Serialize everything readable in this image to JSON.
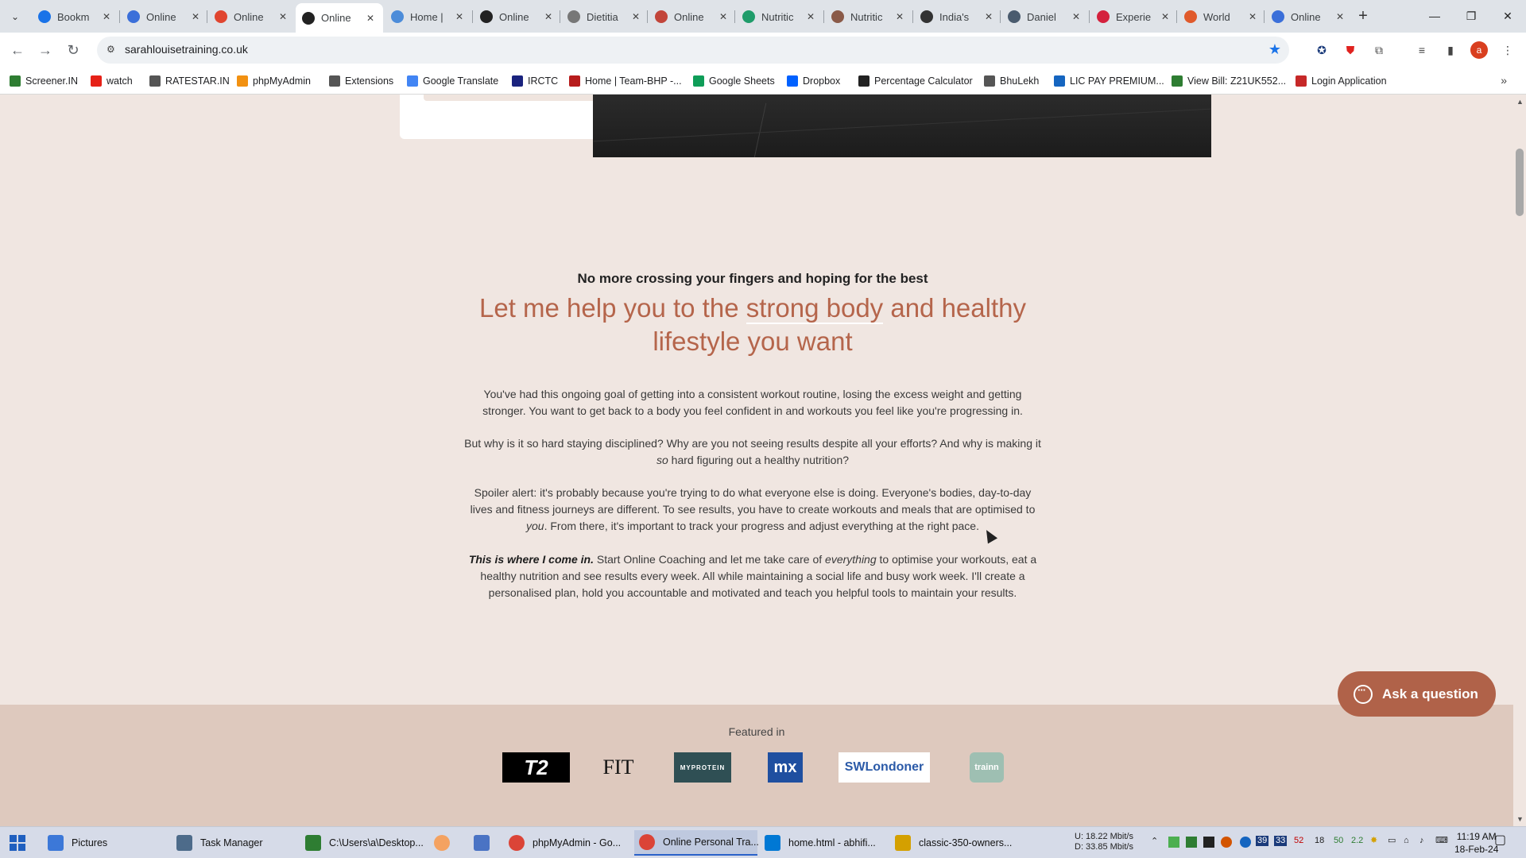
{
  "browser": {
    "tabs": [
      {
        "title": "Bookm",
        "icon_color": "#1a73e8"
      },
      {
        "title": "Online",
        "icon_color": "#3b6fd9"
      },
      {
        "title": "Online",
        "icon_color": "#e0452f"
      },
      {
        "title": "Online",
        "icon_color": "#222222",
        "active": true
      },
      {
        "title": "Home |",
        "icon_color": "#4c8cd9"
      },
      {
        "title": "Online",
        "icon_color": "#222222"
      },
      {
        "title": "Dietitia",
        "icon_color": "#777777"
      },
      {
        "title": "Online",
        "icon_color": "#c2453a"
      },
      {
        "title": "Nutritic",
        "icon_color": "#1f9c6a"
      },
      {
        "title": "Nutritic",
        "icon_color": "#8a5a48"
      },
      {
        "title": "India's",
        "icon_color": "#333333"
      },
      {
        "title": "Daniel",
        "icon_color": "#4a5b6e"
      },
      {
        "title": "Experie",
        "icon_color": "#d4213d"
      },
      {
        "title": "World",
        "icon_color": "#e05a2b"
      },
      {
        "title": "Online",
        "icon_color": "#3b6fd9"
      }
    ],
    "url": "sarahlouisetraining.co.uk",
    "bookmarks": [
      {
        "label": "Screener.IN",
        "color": "#2e7d32"
      },
      {
        "label": "watch",
        "color": "#e62117"
      },
      {
        "label": "RATESTAR.IN",
        "color": "#555555"
      },
      {
        "label": "phpMyAdmin",
        "color": "#f29111"
      },
      {
        "label": "Extensions",
        "color": "#555555"
      },
      {
        "label": "Google Translate",
        "color": "#4285f4"
      },
      {
        "label": "IRCTC",
        "color": "#1a237e"
      },
      {
        "label": "Home | Team-BHP -...",
        "color": "#b71c1c"
      },
      {
        "label": "Google Sheets",
        "color": "#0f9d58"
      },
      {
        "label": "Dropbox",
        "color": "#0061ff"
      },
      {
        "label": "Percentage Calculator",
        "color": "#222222"
      },
      {
        "label": "BhuLekh",
        "color": "#555555"
      },
      {
        "label": "LIC PAY PREMIUM...",
        "color": "#1565c0"
      },
      {
        "label": "View Bill: Z21UK552...",
        "color": "#2e7d32"
      },
      {
        "label": "Login Application",
        "color": "#c62828"
      }
    ]
  },
  "page": {
    "eyebrow": "No more crossing your fingers and hoping for the best",
    "headline_part1": "Let me help you to the ",
    "headline_underline": "strong body",
    "headline_part2": " and healthy lifestyle you want",
    "p1": "You've had this ongoing goal of getting into a consistent workout routine, losing the excess weight and getting stronger. You want to get back to a body you feel confident in and workouts you feel like you're progressing in.",
    "p2_a": "But why is it so hard staying disciplined? Why are you not seeing results despite all your efforts? And why is making it ",
    "p2_em": "so",
    "p2_b": " hard figuring out a healthy nutrition?",
    "p3_a": "Spoiler alert: it's probably because you're trying to do what everyone else is doing. Everyone's bodies, day-to-day lives and fitness journeys are different. To see results, you have to create workouts and meals that are optimised to ",
    "p3_em": "you",
    "p3_b": ". From there, it's important to track your progress and adjust everything at the right pace.",
    "p4_strong": "This is where I come in.",
    "p4_a": " Start Online Coaching and let me take care of ",
    "p4_em": "everything",
    "p4_b": " to optimise your workouts, eat a healthy nutrition and see results every week. All while maintaining a social life and busy work week. I'll create a personalised plan, hold you accountable and motivated and teach you helpful tools to maintain your results.",
    "featured_label": "Featured in",
    "logos": [
      "T2",
      "FIT",
      "MYPROTEIN",
      "mx",
      "SWLondoner",
      "trainn"
    ],
    "ask_button": "Ask a question",
    "accent_color": "#b5654b"
  },
  "taskbar": {
    "items": [
      {
        "label": "Pictures",
        "color": "#3c78d8"
      },
      {
        "label": "Task Manager",
        "color": "#4d6b8a"
      },
      {
        "label": "C:\\Users\\a\\Desktop...",
        "color": "#2e7d32"
      },
      {
        "label": "",
        "color": "#f4a261"
      },
      {
        "label": "",
        "color": "#4a73c4"
      },
      {
        "label": "phpMyAdmin - Go...",
        "color": "#db4437"
      },
      {
        "label": "Online Personal Tra...",
        "color": "#db4437",
        "active": true
      },
      {
        "label": "home.html - abhifi...",
        "color": "#0078d4"
      },
      {
        "label": "classic-350-owners...",
        "color": "#d4a000"
      }
    ],
    "net_up": "U:    18.22 Mbit/s",
    "net_down": "D:    33.85 Mbit/s",
    "tray_nums": [
      "39",
      "33",
      "52",
      "18",
      "50",
      "2.2"
    ],
    "time": "11:19 AM",
    "date": "18-Feb-24"
  }
}
